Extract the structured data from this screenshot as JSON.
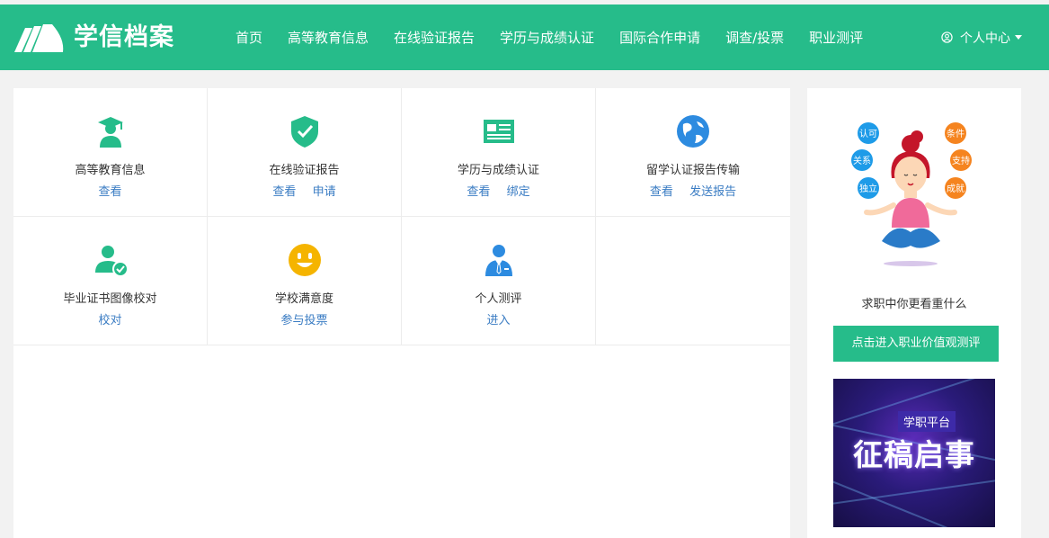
{
  "brand": {
    "name": "学信档案"
  },
  "nav": {
    "items": [
      {
        "label": "首页"
      },
      {
        "label": "高等教育信息"
      },
      {
        "label": "在线验证报告"
      },
      {
        "label": "学历与成绩认证"
      },
      {
        "label": "国际合作申请"
      },
      {
        "label": "调查/投票"
      },
      {
        "label": "职业测评"
      }
    ],
    "user_menu": "个人中心"
  },
  "services": [
    {
      "title": "高等教育信息",
      "links": [
        "查看"
      ],
      "icon": "graduate-icon"
    },
    {
      "title": "在线验证报告",
      "links": [
        "查看",
        "申请"
      ],
      "icon": "shield-check-icon"
    },
    {
      "title": "学历与成绩认证",
      "links": [
        "查看",
        "绑定"
      ],
      "icon": "book-icon"
    },
    {
      "title": "留学认证报告传输",
      "links": [
        "查看",
        "发送报告"
      ],
      "icon": "globe-icon"
    },
    {
      "title": "毕业证书图像校对",
      "links": [
        "校对"
      ],
      "icon": "user-check-icon"
    },
    {
      "title": "学校满意度",
      "links": [
        "参与投票"
      ],
      "icon": "smiley-icon"
    },
    {
      "title": "个人测评",
      "links": [
        "进入"
      ],
      "icon": "suit-person-icon"
    }
  ],
  "sidebar": {
    "bubbles": [
      "认可",
      "关系",
      "独立",
      "条件",
      "支持",
      "成就"
    ],
    "caption": "求职中你更看重什么",
    "button": "点击进入职业价值观测评",
    "banner_tag": "学职平台",
    "banner_title": "征稿启事"
  },
  "colors": {
    "primary": "#26bc8a",
    "link": "#3a7cc3",
    "bubble_blue": "#1e9be8",
    "bubble_orange": "#f5841f"
  }
}
